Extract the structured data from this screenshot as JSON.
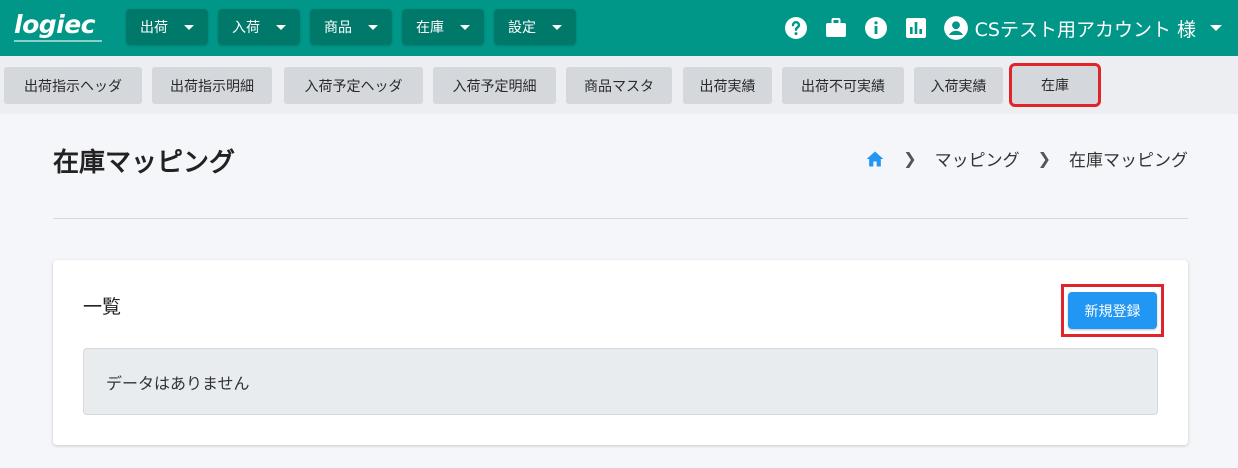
{
  "header": {
    "logo_text": "logiec",
    "nav": [
      {
        "label": "出荷"
      },
      {
        "label": "入荷"
      },
      {
        "label": "商品"
      },
      {
        "label": "在庫"
      },
      {
        "label": "設定"
      }
    ],
    "icons": [
      "help-icon",
      "briefcase-icon",
      "info-icon",
      "bar-chart-icon",
      "account-icon"
    ],
    "account_name": "CSテスト用アカウント 様"
  },
  "subnav": {
    "tabs": [
      {
        "label": "出荷指示ヘッダ"
      },
      {
        "label": "出荷指示明細"
      },
      {
        "label": "入荷予定ヘッダ"
      },
      {
        "label": "入荷予定明細"
      },
      {
        "label": "商品マスタ"
      },
      {
        "label": "出荷実績"
      },
      {
        "label": "出荷不可実績"
      },
      {
        "label": "入荷実績"
      },
      {
        "label": "在庫"
      }
    ],
    "active_tab": "在庫"
  },
  "page": {
    "title": "在庫マッピング",
    "breadcrumb": [
      "マッピング",
      "在庫マッピング"
    ]
  },
  "card": {
    "title": "一覧",
    "new_button_label": "新規登録",
    "empty_message": "データはありません"
  },
  "colors": {
    "header_bg": "#009688",
    "nav_button_bg": "#00796b",
    "primary_button": "#2196f3",
    "highlight_outline": "#e0242b",
    "home_icon": "#2196f3"
  }
}
